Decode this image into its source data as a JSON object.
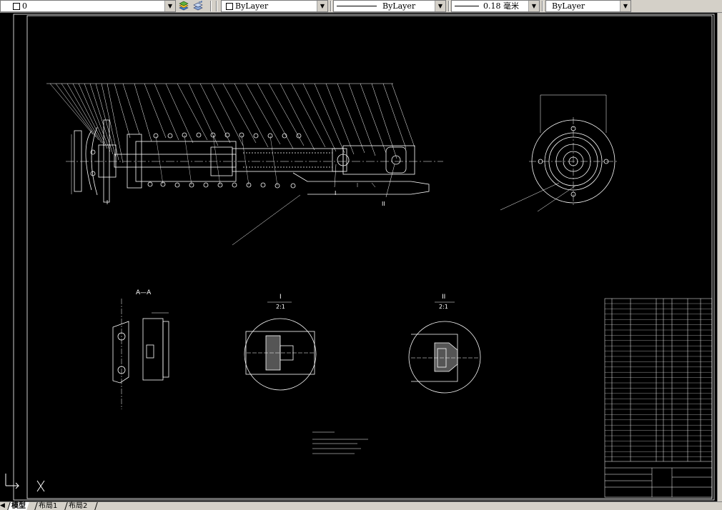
{
  "toolbar": {
    "layer_name": "0",
    "color_value": "ByLayer",
    "linetype_value": "ByLayer",
    "lineweight_value": "0.18 毫米",
    "plotstyle_value": "ByLayer"
  },
  "drawing": {
    "section_label": "A—A",
    "detail_one_label": "I",
    "detail_two_label": "II",
    "detail_scale": "2:1",
    "detail_one_callout": "I",
    "detail_two_callout": "II"
  },
  "tabs": {
    "nav_prev": "◀",
    "model": "模型",
    "layout1": "布局1",
    "layout2": "布局2"
  },
  "colors": {
    "background": "#000000",
    "lines": "#ffffff",
    "toolbar": "#d4d0c8"
  }
}
